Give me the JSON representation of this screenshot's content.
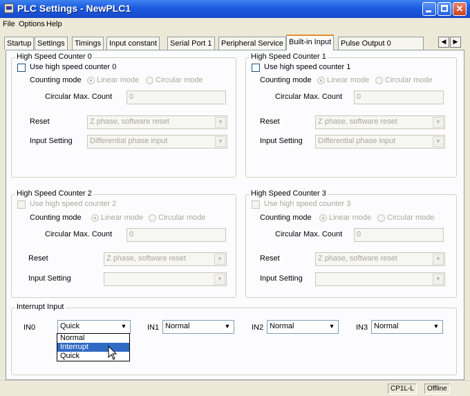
{
  "window": {
    "title": "PLC Settings - NewPLC1"
  },
  "menu": [
    "File",
    "Options",
    "Help"
  ],
  "tabs": [
    "Startup",
    "Settings",
    "Timings",
    "Input constant",
    "Serial Port 1",
    "Peripheral Service",
    "Built-in Input",
    "Pulse Output 0"
  ],
  "active_tab": "Built-in Input",
  "counters": [
    {
      "title": "High Speed Counter 0",
      "use_label": "Use high speed counter 0",
      "mode_label": "Counting mode",
      "linear": "Linear mode",
      "circular": "Circular mode",
      "max_label": "Circular Max. Count",
      "max_value": "0",
      "reset_label": "Reset",
      "reset_value": "Z phase, software reset",
      "input_label": "Input Setting",
      "input_value": "Differential phase input"
    },
    {
      "title": "High Speed Counter 1",
      "use_label": "Use high speed counter 1",
      "mode_label": "Counting mode",
      "linear": "Linear mode",
      "circular": "Circular mode",
      "max_label": "Circular Max. Count",
      "max_value": "0",
      "reset_label": "Reset",
      "reset_value": "Z phase, software reset",
      "input_label": "Input Setting",
      "input_value": "Differential phase input"
    },
    {
      "title": "High Speed Counter 2",
      "use_label": "Use high speed counter 2",
      "mode_label": "Counting mode",
      "linear": "Linear mode",
      "circular": "Circular mode",
      "max_label": "Circular Max. Count",
      "max_value": "0",
      "reset_label": "Reset",
      "reset_value": "Z phase, software reset",
      "input_label": "Input Setting",
      "input_value": ""
    },
    {
      "title": "High Speed Counter 3",
      "use_label": "Use high speed counter 3",
      "mode_label": "Counting mode",
      "linear": "Linear mode",
      "circular": "Circular mode",
      "max_label": "Circular Max. Count",
      "max_value": "0",
      "reset_label": "Reset",
      "reset_value": "Z phase, software reset",
      "input_label": "Input Setting",
      "input_value": ""
    }
  ],
  "interrupt": {
    "title": "Interrupt Input",
    "inputs": [
      {
        "label": "IN0",
        "value": "Quick"
      },
      {
        "label": "IN1",
        "value": "Normal"
      },
      {
        "label": "IN2",
        "value": "Normal"
      },
      {
        "label": "IN3",
        "value": "Normal"
      }
    ],
    "dropdown_options": [
      "Normal",
      "Interrupt",
      "Quick"
    ],
    "dropdown_highlighted": "Interrupt"
  },
  "status": {
    "model": "CP1L-L",
    "state": "Offline"
  },
  "icons": {
    "app": "plc-app-icon",
    "minimize": "minimize-icon",
    "maximize": "maximize-icon",
    "close": "close-icon",
    "scroll_left": "arrow-left-icon",
    "scroll_right": "arrow-right-icon",
    "dropdown": "chevron-down-icon",
    "cursor": "pointer-cursor-icon"
  },
  "colors": {
    "titlebar": "#1c5ae0",
    "selection": "#316ac5",
    "active_tab_accent": "#e68b2c"
  }
}
